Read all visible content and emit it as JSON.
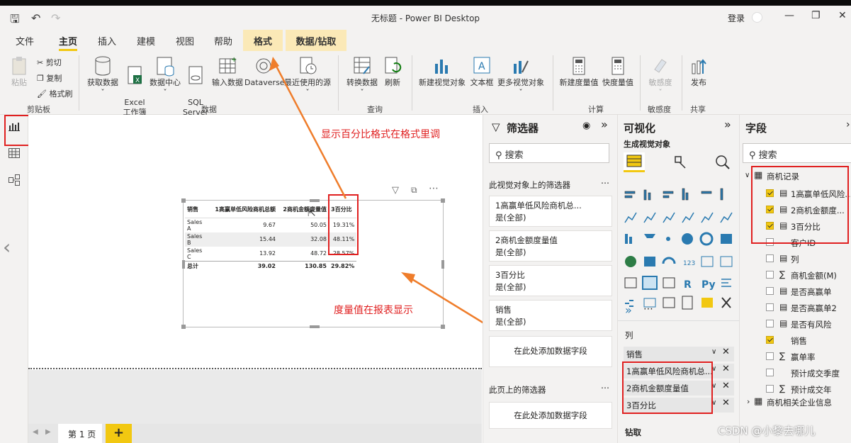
{
  "window": {
    "title": "无标题 - Power BI Desktop",
    "login": "登录"
  },
  "menu": {
    "tabs": [
      "文件",
      "主页",
      "插入",
      "建模",
      "视图",
      "帮助"
    ],
    "active": "主页",
    "context_tabs": [
      "格式",
      "数据/钻取"
    ]
  },
  "ribbon": {
    "clipboard": {
      "paste": "粘贴",
      "cut": "剪切",
      "copy": "复制",
      "format_painter": "格式刷",
      "group": "剪贴板"
    },
    "data": {
      "get_data": "获取数据",
      "excel": "Excel\n工作簿",
      "data_hub": "数据中心",
      "sql": "SQL\nServer",
      "enter_data": "输入数据",
      "dataverse": "Dataverse",
      "recent": "最近使用的源",
      "group": "数据"
    },
    "query": {
      "transform": "转换数据",
      "refresh": "刷新",
      "group": "查询"
    },
    "insert": {
      "new_visual": "新建视觉对象",
      "textbox": "文本框",
      "more_visuals": "更多视觉对象",
      "group": "插入"
    },
    "calc": {
      "new_measure": "新建度量值",
      "quick_measure": "快度量值",
      "group": "计算"
    },
    "sensitivity": {
      "label": "敏感度",
      "group": "敏感度"
    },
    "share": {
      "publish": "发布",
      "group": "共享"
    }
  },
  "table": {
    "headers": [
      "销售",
      "1高赢单低风险商机总额",
      "2商机金额度量值",
      "3百分比"
    ],
    "rows": [
      [
        "Sales A",
        "9.67",
        "50.05",
        "19.31%"
      ],
      [
        "Sales B",
        "15.44",
        "32.08",
        "48.11%"
      ],
      [
        "Sales C",
        "13.92",
        "48.72",
        "28.57%"
      ]
    ],
    "total": [
      "总计",
      "39.02",
      "130.85",
      "29.82%"
    ]
  },
  "annotations": {
    "format_tip": "显示百分比格式在格式里调",
    "measure_tip": "度量值在报表显示"
  },
  "pages": {
    "current": "第 1 页",
    "add": "+"
  },
  "filters": {
    "title": "筛选器",
    "search": "搜索",
    "visual_section": "此视觉对象上的筛选器",
    "cards": [
      {
        "name": "1高赢单低风险商机总...",
        "state": "是(全部)"
      },
      {
        "name": "2商机金额度量值",
        "state": "是(全部)"
      },
      {
        "name": "3百分比",
        "state": "是(全部)"
      },
      {
        "name": "销售",
        "state": "是(全部)"
      }
    ],
    "add_field": "在此处添加数据字段",
    "page_section": "此页上的筛选器",
    "add_field_page": "在此处添加数据字段"
  },
  "viz": {
    "title": "可视化",
    "build": "生成视觉对象",
    "columns_label": "列",
    "wells": [
      "销售",
      "1高赢单低风险商机总...",
      "2商机金额度量值",
      "3百分比"
    ],
    "drill": "钻取"
  },
  "fields": {
    "title": "字段",
    "search": "搜索",
    "table1": "商机记录",
    "items": [
      {
        "label": "1高赢单低风险...",
        "checked": true,
        "kind": "calc"
      },
      {
        "label": "2商机金额度...",
        "checked": true,
        "kind": "calc"
      },
      {
        "label": "3百分比",
        "checked": true,
        "kind": "calc"
      },
      {
        "label": "客户ID",
        "checked": false,
        "kind": "plain"
      },
      {
        "label": "列",
        "checked": false,
        "kind": "calc"
      },
      {
        "label": "商机金额(M)",
        "checked": false,
        "kind": "sum"
      },
      {
        "label": "是否高赢单",
        "checked": false,
        "kind": "calc"
      },
      {
        "label": "是否高赢单2",
        "checked": false,
        "kind": "calc"
      },
      {
        "label": "是否有风险",
        "checked": false,
        "kind": "calc"
      },
      {
        "label": "销售",
        "checked": true,
        "kind": "plain"
      },
      {
        "label": "赢单率",
        "checked": false,
        "kind": "sum"
      },
      {
        "label": "预计成交季度",
        "checked": false,
        "kind": "plain"
      },
      {
        "label": "预计成交年",
        "checked": false,
        "kind": "sum"
      }
    ],
    "table2": "商机相关企业信息"
  },
  "watermark": "CSDN @小黎去哪儿",
  "colors": {
    "accent": "#f2c811",
    "annotation": "#e02020"
  }
}
